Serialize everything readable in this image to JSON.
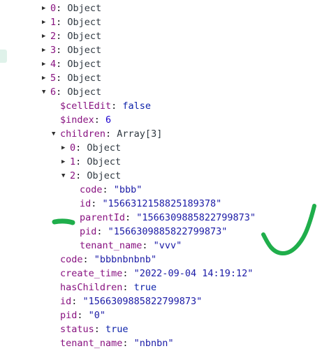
{
  "tree": {
    "rows": [
      {
        "indent": 0,
        "toggle": "collapsed",
        "key": "0",
        "value": "Object",
        "kind": "obj"
      },
      {
        "indent": 0,
        "toggle": "collapsed",
        "key": "1",
        "value": "Object",
        "kind": "obj"
      },
      {
        "indent": 0,
        "toggle": "collapsed",
        "key": "2",
        "value": "Object",
        "kind": "obj"
      },
      {
        "indent": 0,
        "toggle": "collapsed",
        "key": "3",
        "value": "Object",
        "kind": "obj"
      },
      {
        "indent": 0,
        "toggle": "collapsed",
        "key": "4",
        "value": "Object",
        "kind": "obj"
      },
      {
        "indent": 0,
        "toggle": "collapsed",
        "key": "5",
        "value": "Object",
        "kind": "obj"
      },
      {
        "indent": 0,
        "toggle": "expanded",
        "key": "6",
        "value": "Object",
        "kind": "obj"
      },
      {
        "indent": 1,
        "toggle": "none",
        "key": "$cellEdit",
        "value": "false",
        "kind": "bool"
      },
      {
        "indent": 1,
        "toggle": "none",
        "key": "$index",
        "value": "6",
        "kind": "num"
      },
      {
        "indent": 1,
        "toggle": "expanded",
        "key": "children",
        "value": "Array[3]",
        "kind": "obj"
      },
      {
        "indent": 2,
        "toggle": "collapsed",
        "key": "0",
        "value": "Object",
        "kind": "obj"
      },
      {
        "indent": 2,
        "toggle": "collapsed",
        "key": "1",
        "value": "Object",
        "kind": "obj"
      },
      {
        "indent": 2,
        "toggle": "expanded",
        "key": "2",
        "value": "Object",
        "kind": "obj"
      },
      {
        "indent": 3,
        "toggle": "none",
        "key": "code",
        "value": "\"bbb\"",
        "kind": "str"
      },
      {
        "indent": 3,
        "toggle": "none",
        "key": "id",
        "value": "\"1566312158825189378\"",
        "kind": "str"
      },
      {
        "indent": 3,
        "toggle": "none",
        "key": "parentId",
        "value": "\"1566309885822799873\"",
        "kind": "str"
      },
      {
        "indent": 3,
        "toggle": "none",
        "key": "pid",
        "value": "\"1566309885822799873\"",
        "kind": "str"
      },
      {
        "indent": 3,
        "toggle": "none",
        "key": "tenant_name",
        "value": "\"vvv\"",
        "kind": "str"
      },
      {
        "indent": 1,
        "toggle": "none",
        "key": "code",
        "value": "\"bbbnbnbnb\"",
        "kind": "str"
      },
      {
        "indent": 1,
        "toggle": "none",
        "key": "create_time",
        "value": "\"2022-09-04 14:19:12\"",
        "kind": "str"
      },
      {
        "indent": 1,
        "toggle": "none",
        "key": "hasChildren",
        "value": "true",
        "kind": "bool"
      },
      {
        "indent": 1,
        "toggle": "none",
        "key": "id",
        "value": "\"1566309885822799873\"",
        "kind": "str"
      },
      {
        "indent": 1,
        "toggle": "none",
        "key": "pid",
        "value": "\"0\"",
        "kind": "str"
      },
      {
        "indent": 1,
        "toggle": "none",
        "key": "status",
        "value": "true",
        "kind": "bool"
      },
      {
        "indent": 1,
        "toggle": "none",
        "key": "tenant_name",
        "value": "\"nbnbn\"",
        "kind": "str"
      }
    ]
  },
  "colors": {
    "key": "#881280",
    "string": "#1a1aa6",
    "number": "#1c00cf",
    "annotation": "#1fae4b",
    "gutter_marker": "#dff2ea"
  }
}
